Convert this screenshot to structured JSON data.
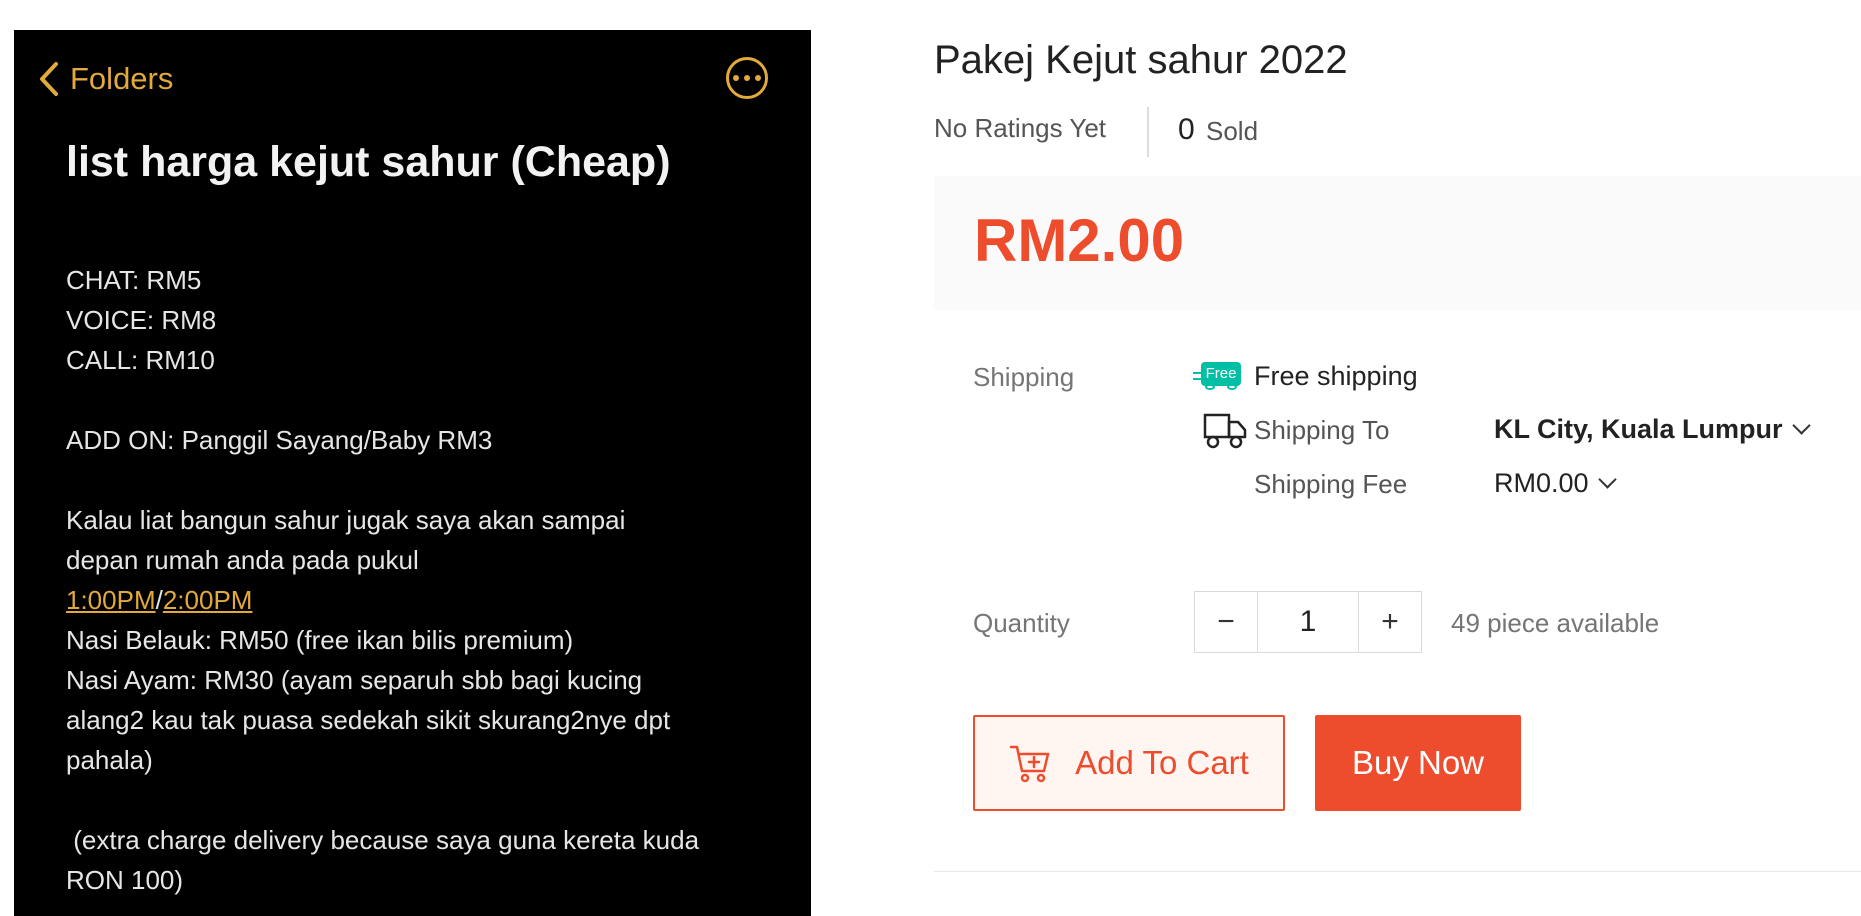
{
  "note": {
    "back_label": "Folders",
    "title": "list harga kejut sahur (Cheap)",
    "lines": {
      "l1": "CHAT: RM5",
      "l2": "VOICE: RM8",
      "l3": "CALL: RM10",
      "l4": "ADD ON: Panggil Sayang/Baby RM3",
      "l5": "Kalau liat bangun sahur jugak saya akan sampai",
      "l6": "depan rumah anda pada pukul",
      "time1": "1:00PM",
      "time_sep": "/",
      "time2": "2:00PM",
      "l8": "Nasi Belauk: RM50 (free ikan bilis premium)",
      "l9": "Nasi Ayam: RM30 (ayam separuh sbb bagi kucing",
      "l10": "alang2 kau tak puasa sedekah sikit skurang2nye dpt",
      "l11": "pahala)",
      "l12": " (extra charge delivery because saya guna kereta kuda",
      "l13": "RON 100)"
    }
  },
  "product": {
    "title": "Pakej Kejut sahur 2022",
    "rating_text": "No Ratings Yet",
    "sold_count": "0",
    "sold_label": "Sold",
    "price": "RM2.00",
    "shipping_label": "Shipping",
    "free_badge": "Free",
    "free_shipping": "Free shipping",
    "shipping_to_label": "Shipping To",
    "shipping_to_value": "KL City, Kuala Lumpur",
    "shipping_fee_label": "Shipping Fee",
    "shipping_fee_value": "RM0.00",
    "quantity_label": "Quantity",
    "quantity_value": "1",
    "decrement": "−",
    "increment": "+",
    "stock_text": "49 piece available",
    "add_to_cart": "Add To Cart",
    "buy_now": "Buy Now"
  },
  "colors": {
    "accent": "#ee4d2d",
    "note_accent": "#e2a93b",
    "free_badge": "#00bfa5"
  }
}
